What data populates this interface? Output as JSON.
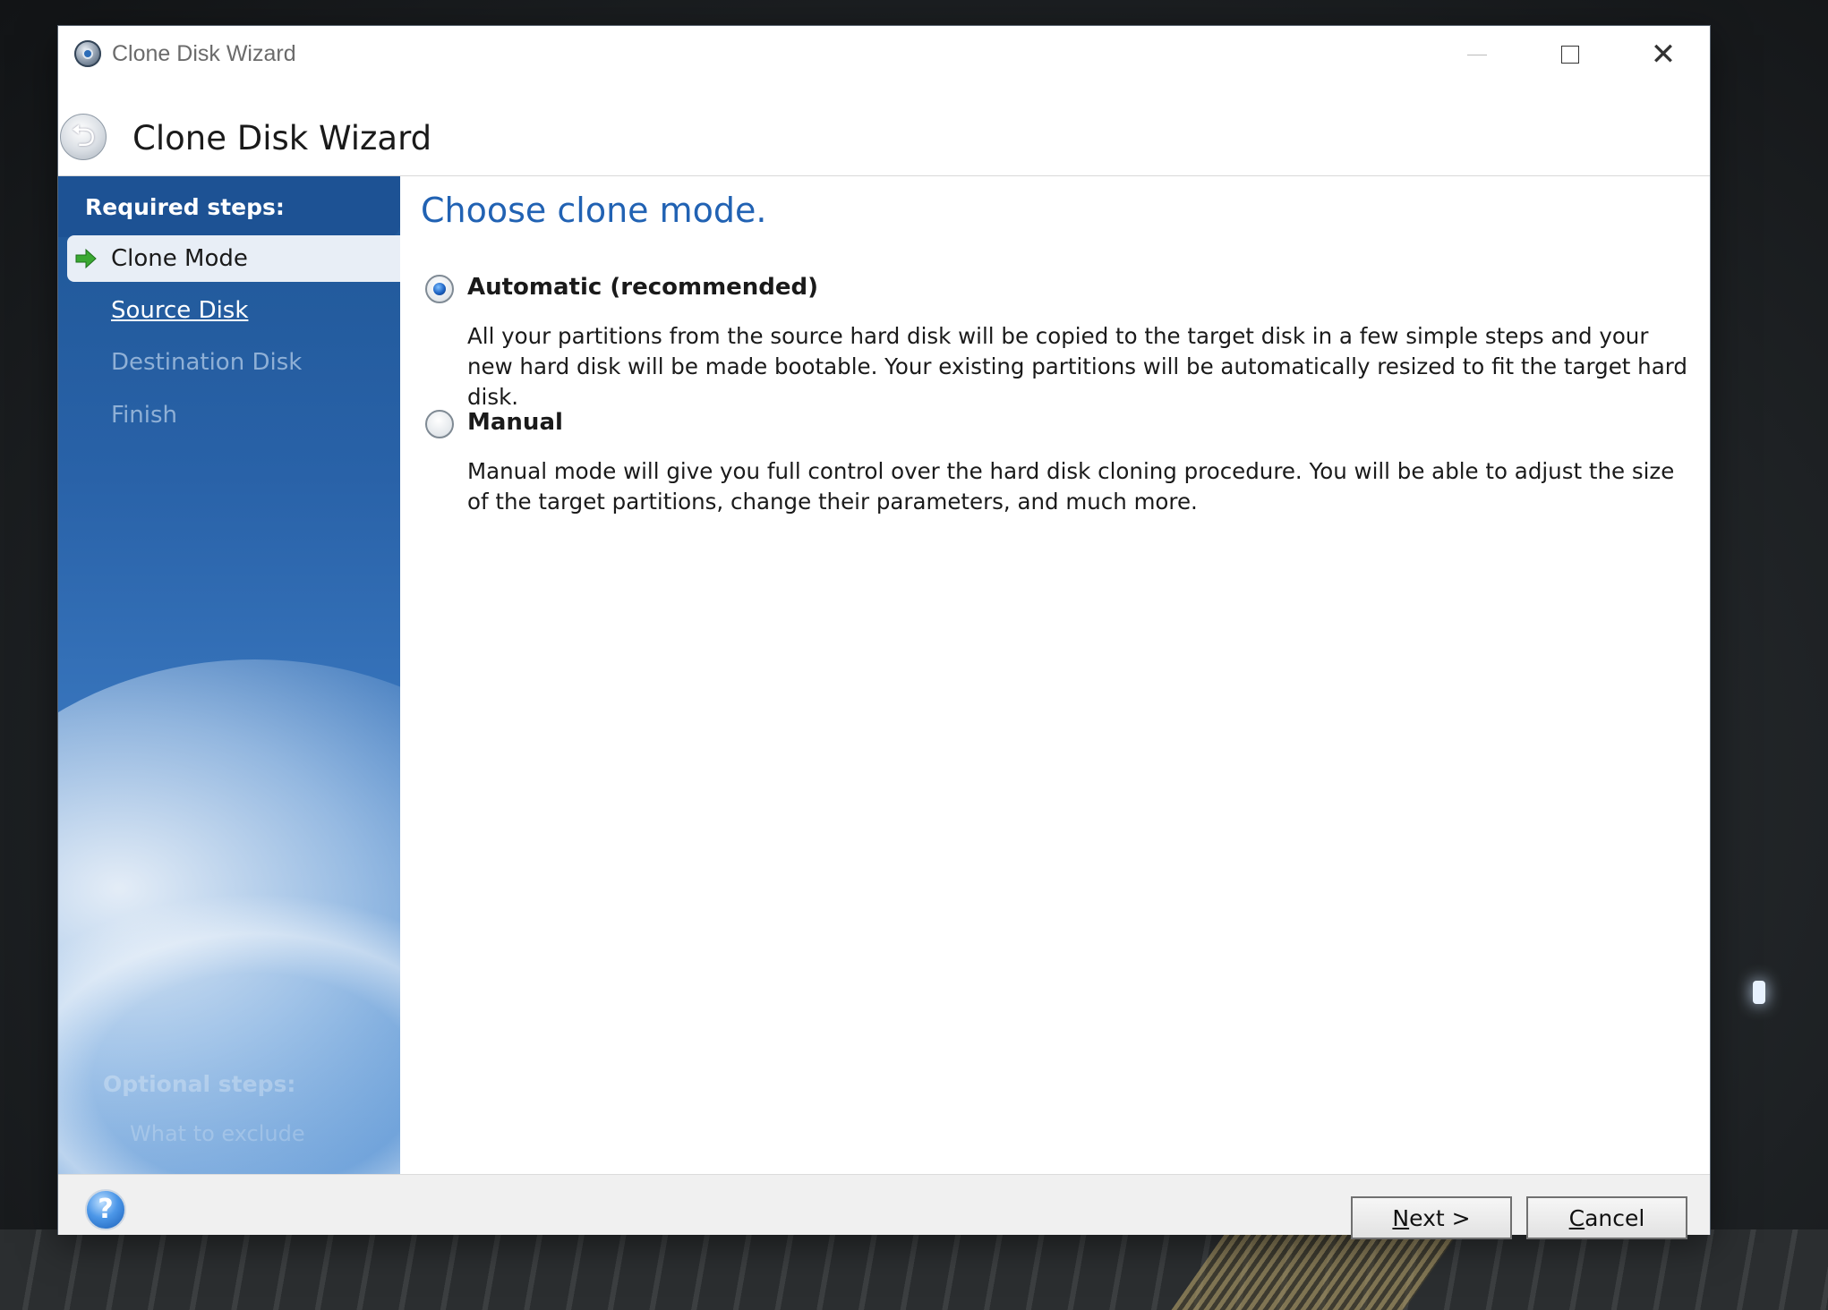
{
  "window": {
    "title": "Clone Disk Wizard",
    "controls": {
      "minimize": "",
      "maximize": "",
      "close": "✕"
    }
  },
  "header": {
    "title": "Clone Disk Wizard",
    "back_icon": "back-arrow-icon"
  },
  "sidebar": {
    "required_heading": "Required steps:",
    "steps": [
      {
        "label": "Clone Mode",
        "state": "active"
      },
      {
        "label": "Source Disk",
        "state": "link"
      },
      {
        "label": "Destination Disk",
        "state": "disabled"
      },
      {
        "label": "Finish",
        "state": "disabled"
      }
    ],
    "optional_heading": "Optional steps:",
    "optional_items": [
      "What to exclude"
    ]
  },
  "content": {
    "heading": "Choose clone mode.",
    "options": [
      {
        "label": "Automatic (recommended)",
        "selected": true,
        "description": "All your partitions from the source hard disk will be copied to the target disk in a few simple steps and your new hard disk will be made bootable. Your existing partitions will be automatically resized to fit the target hard disk."
      },
      {
        "label": "Manual",
        "selected": false,
        "description": "Manual mode will give you full control over the hard disk cloning procedure. You will be able to adjust the size of the target partitions, change their parameters, and much more."
      }
    ]
  },
  "footer": {
    "help": "?",
    "next": {
      "mnemonic": "N",
      "rest": "ext >"
    },
    "cancel": {
      "mnemonic": "C",
      "rest": "ancel"
    }
  },
  "colors": {
    "accent_heading": "#2162b3",
    "sidebar_top": "#1f5797",
    "sidebar_bottom": "#6fa2da"
  }
}
